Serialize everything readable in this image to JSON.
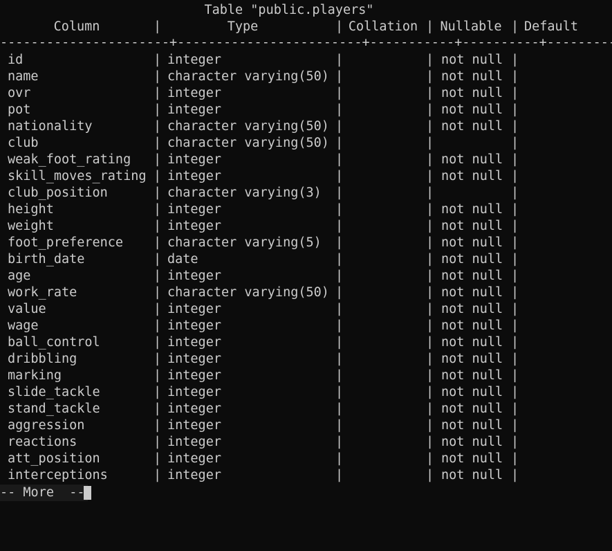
{
  "window": {
    "background": "#0c0c0c",
    "foreground": "#cccccc"
  },
  "table_title": "Table \"public.players\"",
  "headers": {
    "column": "Column",
    "type": "Type",
    "collation": "Collation",
    "nullable": "Nullable",
    "default": "Default"
  },
  "divider": "----------------------+------------------------+-----------+----------+---------",
  "separator_char": "|",
  "rows": [
    {
      "column": "id",
      "type": "integer",
      "nullable": "not null"
    },
    {
      "column": "name",
      "type": "character varying(50)",
      "nullable": "not null"
    },
    {
      "column": "ovr",
      "type": "integer",
      "nullable": "not null"
    },
    {
      "column": "pot",
      "type": "integer",
      "nullable": "not null"
    },
    {
      "column": "nationality",
      "type": "character varying(50)",
      "nullable": "not null"
    },
    {
      "column": "club",
      "type": "character varying(50)",
      "nullable": ""
    },
    {
      "column": "weak_foot_rating",
      "type": "integer",
      "nullable": "not null"
    },
    {
      "column": "skill_moves_rating",
      "type": "integer",
      "nullable": "not null"
    },
    {
      "column": "club_position",
      "type": "character varying(3)",
      "nullable": ""
    },
    {
      "column": "height",
      "type": "integer",
      "nullable": "not null"
    },
    {
      "column": "weight",
      "type": "integer",
      "nullable": "not null"
    },
    {
      "column": "foot_preference",
      "type": "character varying(5)",
      "nullable": "not null"
    },
    {
      "column": "birth_date",
      "type": "date",
      "nullable": "not null"
    },
    {
      "column": "age",
      "type": "integer",
      "nullable": "not null"
    },
    {
      "column": "work_rate",
      "type": "character varying(50)",
      "nullable": "not null"
    },
    {
      "column": "value",
      "type": "integer",
      "nullable": "not null"
    },
    {
      "column": "wage",
      "type": "integer",
      "nullable": "not null"
    },
    {
      "column": "ball_control",
      "type": "integer",
      "nullable": "not null"
    },
    {
      "column": "dribbling",
      "type": "integer",
      "nullable": "not null"
    },
    {
      "column": "marking",
      "type": "integer",
      "nullable": "not null"
    },
    {
      "column": "slide_tackle",
      "type": "integer",
      "nullable": "not null"
    },
    {
      "column": "stand_tackle",
      "type": "integer",
      "nullable": "not null"
    },
    {
      "column": "aggression",
      "type": "integer",
      "nullable": "not null"
    },
    {
      "column": "reactions",
      "type": "integer",
      "nullable": "not null"
    },
    {
      "column": "att_position",
      "type": "integer",
      "nullable": "not null"
    },
    {
      "column": "interceptions",
      "type": "integer",
      "nullable": "not null"
    }
  ],
  "pager_prompt": "-- More  --"
}
